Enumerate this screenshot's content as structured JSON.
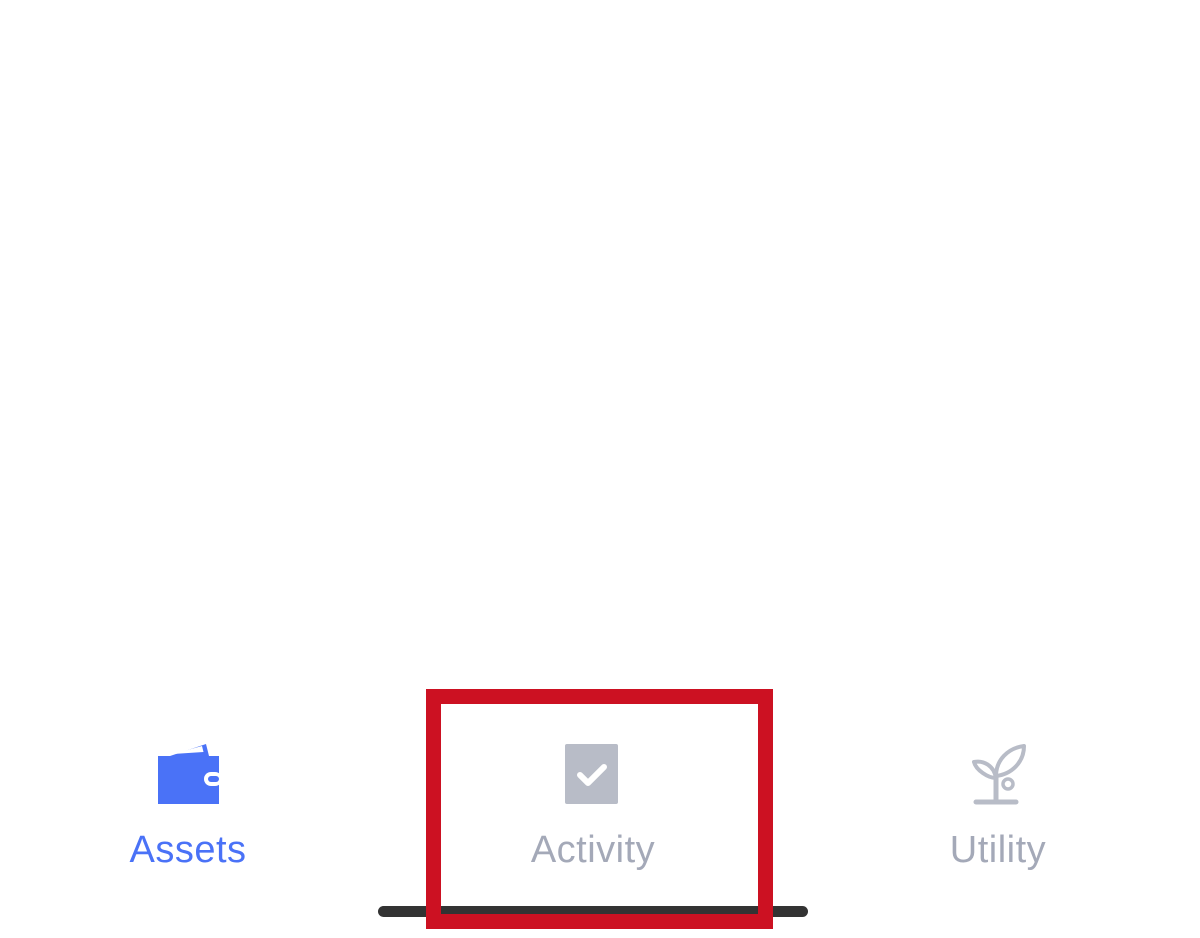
{
  "colors": {
    "active": "#4a72f7",
    "inactive": "#a4a9b8",
    "highlight": "#cc1122",
    "home_indicator": "#333333",
    "background": "#ffffff"
  },
  "tab_bar": {
    "tabs": [
      {
        "label": "Assets",
        "icon": "wallet-icon",
        "active": true
      },
      {
        "label": "Activity",
        "icon": "checkbox-icon",
        "active": false
      },
      {
        "label": "Utility",
        "icon": "sprout-icon",
        "active": false
      }
    ]
  }
}
